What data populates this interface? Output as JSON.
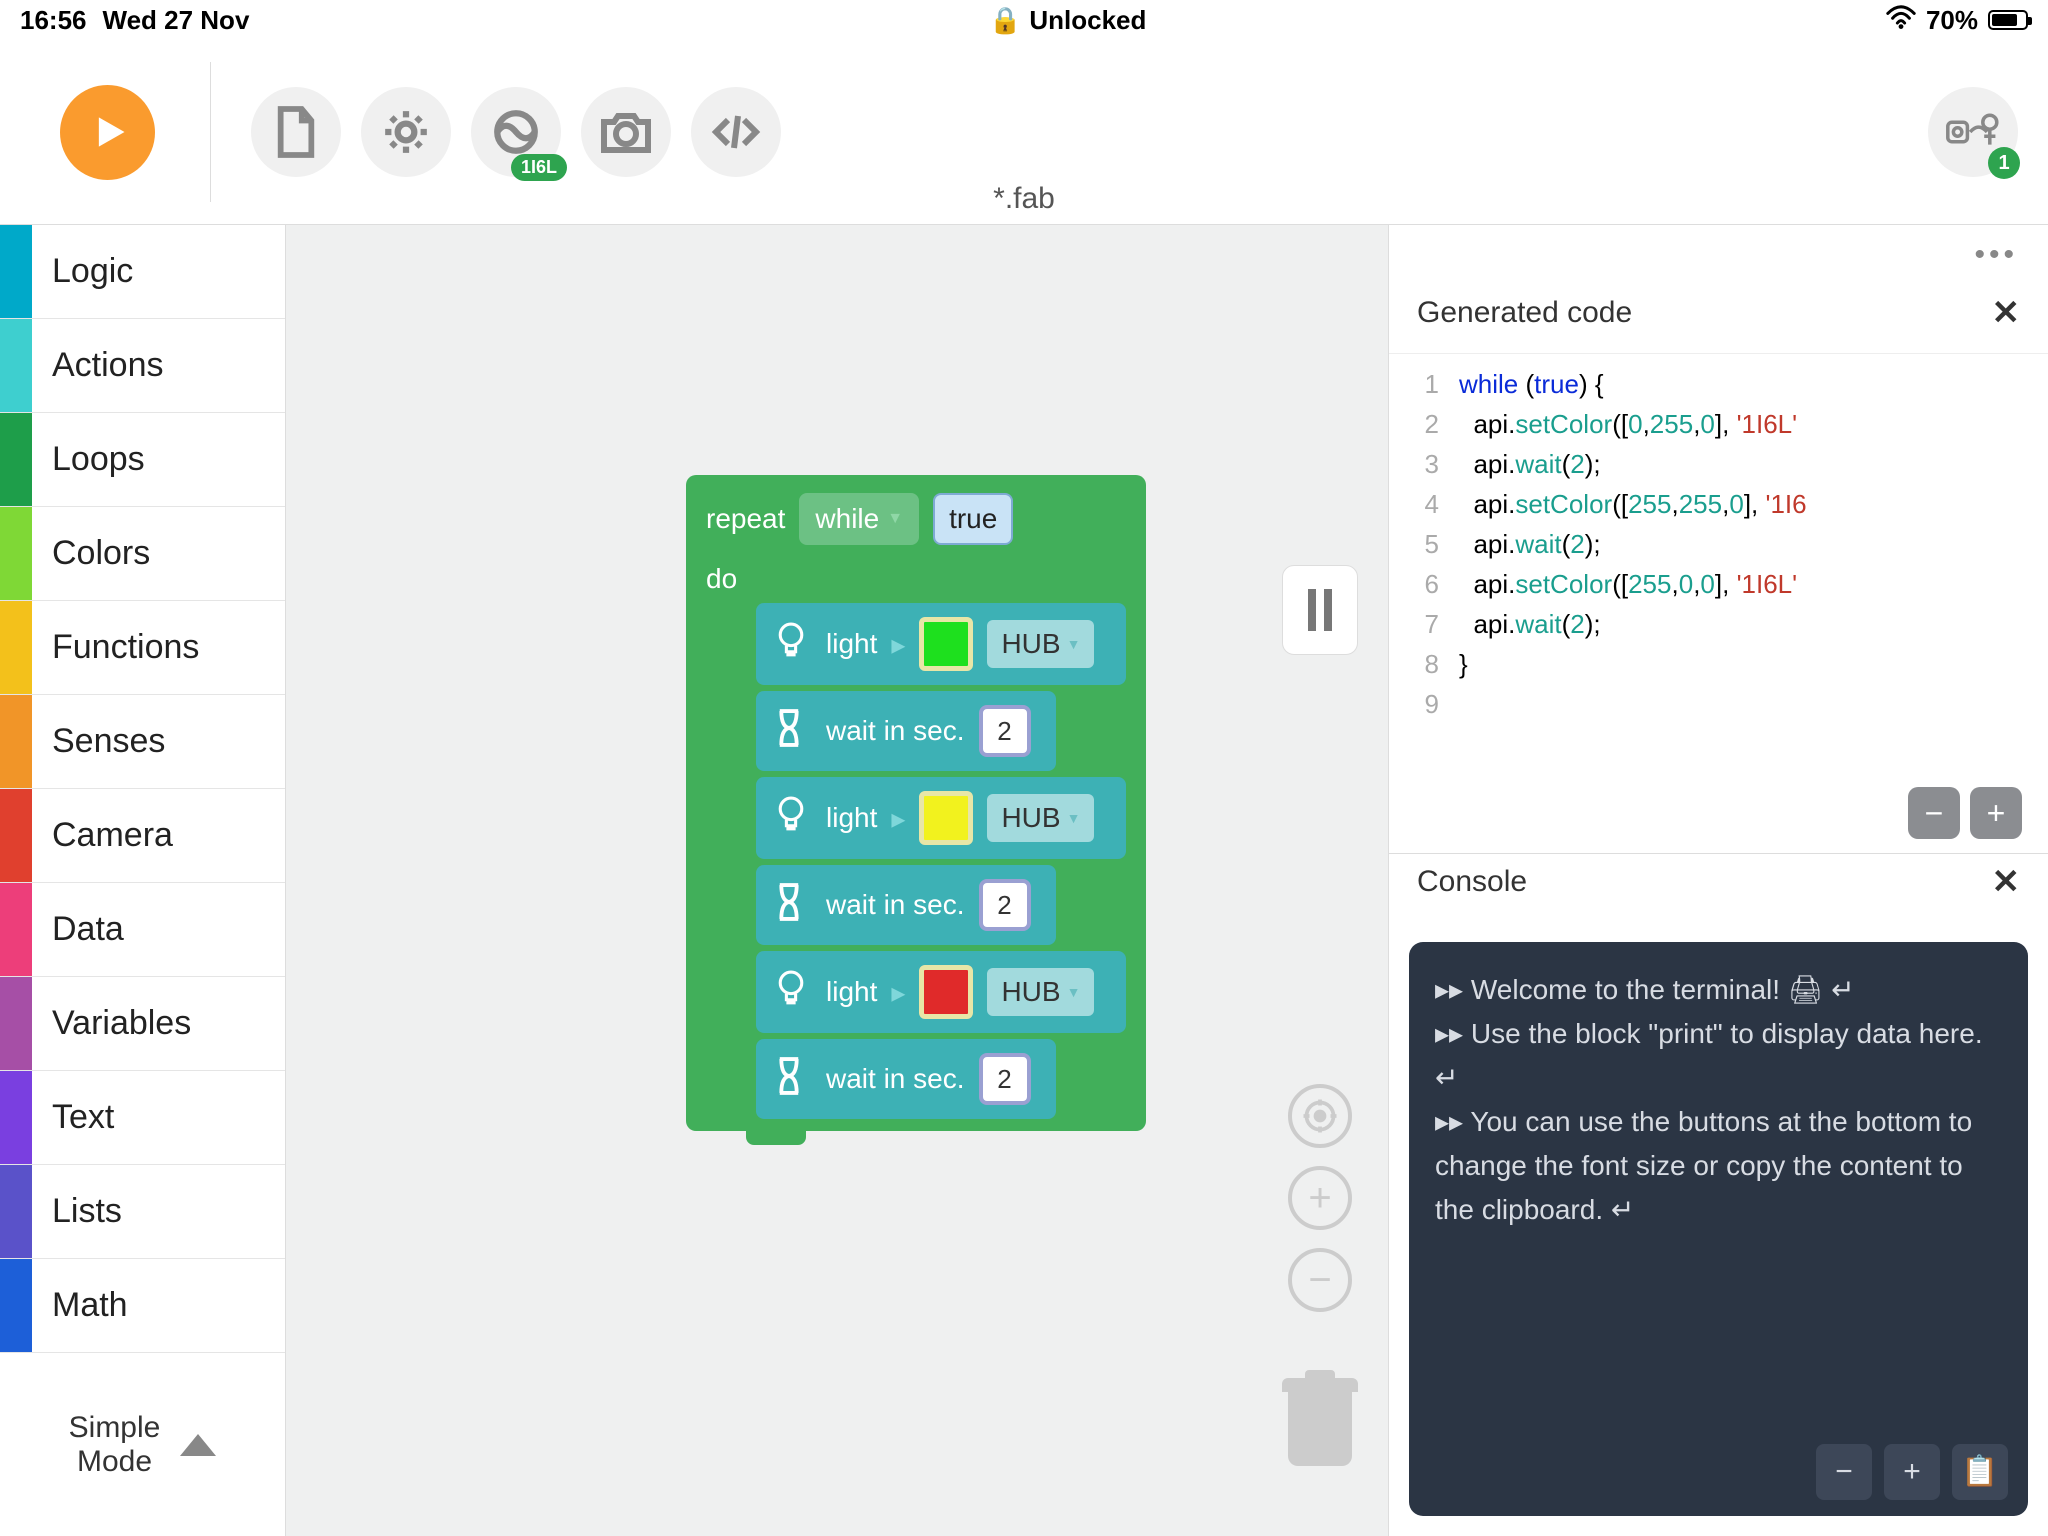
{
  "status": {
    "time": "16:56",
    "date": "Wed 27 Nov",
    "lock": "Unlocked",
    "battery": "70%"
  },
  "toolbar": {
    "conn_badge": "1I6L",
    "hub_count": "1",
    "filename": "*.fab"
  },
  "side": {
    "cats": [
      {
        "label": "Logic",
        "color": "#00a9c9"
      },
      {
        "label": "Actions",
        "color": "#3ecfcf"
      },
      {
        "label": "Loops",
        "color": "#1e9e4a"
      },
      {
        "label": "Colors",
        "color": "#7fd836"
      },
      {
        "label": "Functions",
        "color": "#f3c11b"
      },
      {
        "label": "Senses",
        "color": "#f19528"
      },
      {
        "label": "Camera",
        "color": "#e0402e"
      },
      {
        "label": "Data",
        "color": "#ed3e7a"
      },
      {
        "label": "Variables",
        "color": "#a64fa6"
      },
      {
        "label": "Text",
        "color": "#7a3fe0"
      },
      {
        "label": "Lists",
        "color": "#5a52c9"
      },
      {
        "label": "Math",
        "color": "#1d5fd8"
      }
    ],
    "mode": "Simple\nMode"
  },
  "blocks": {
    "repeat": "repeat",
    "while": "while",
    "true": "true",
    "do": "do",
    "light": "light",
    "hub": "HUB",
    "wait": "wait in sec.",
    "wait_val": "2",
    "colors": [
      "#1ee01e",
      "#f2f21e",
      "#e02a2a"
    ]
  },
  "code": {
    "title": "Generated code",
    "lines": [
      {
        "n": "1",
        "t": [
          "kw:while ",
          "txt:(",
          "kw:true",
          "txt:) {"
        ]
      },
      {
        "n": "2",
        "t": [
          "txt:  api.",
          "fn:setColor",
          "txt:([",
          "num:0",
          "txt:,",
          "num:255",
          "txt:,",
          "num:0",
          "txt:], ",
          "str:'1I6L'"
        ]
      },
      {
        "n": "3",
        "t": [
          "txt:  api.",
          "fn:wait",
          "txt:(",
          "num:2",
          "txt:);"
        ]
      },
      {
        "n": "4",
        "t": [
          "txt:  api.",
          "fn:setColor",
          "txt:([",
          "num:255",
          "txt:,",
          "num:255",
          "txt:,",
          "num:0",
          "txt:], ",
          "str:'1I6"
        ]
      },
      {
        "n": "5",
        "t": [
          "txt:  api.",
          "fn:wait",
          "txt:(",
          "num:2",
          "txt:);"
        ]
      },
      {
        "n": "6",
        "t": [
          "txt:  api.",
          "fn:setColor",
          "txt:([",
          "num:255",
          "txt:,",
          "num:0",
          "txt:,",
          "num:0",
          "txt:], ",
          "str:'1I6L'"
        ]
      },
      {
        "n": "7",
        "t": [
          "txt:  api.",
          "fn:wait",
          "txt:(",
          "num:2",
          "txt:);"
        ]
      },
      {
        "n": "8",
        "t": [
          "txt:}"
        ]
      },
      {
        "n": "9",
        "t": []
      }
    ]
  },
  "console": {
    "title": "Console",
    "lines": [
      "▸▸ Welcome to the terminal! 🖨 ↵",
      "▸▸ Use the block \"print\" to display data here. ↵",
      "▸▸ You can use the buttons at the bottom to change the font size or copy the content to the clipboard. ↵"
    ]
  }
}
